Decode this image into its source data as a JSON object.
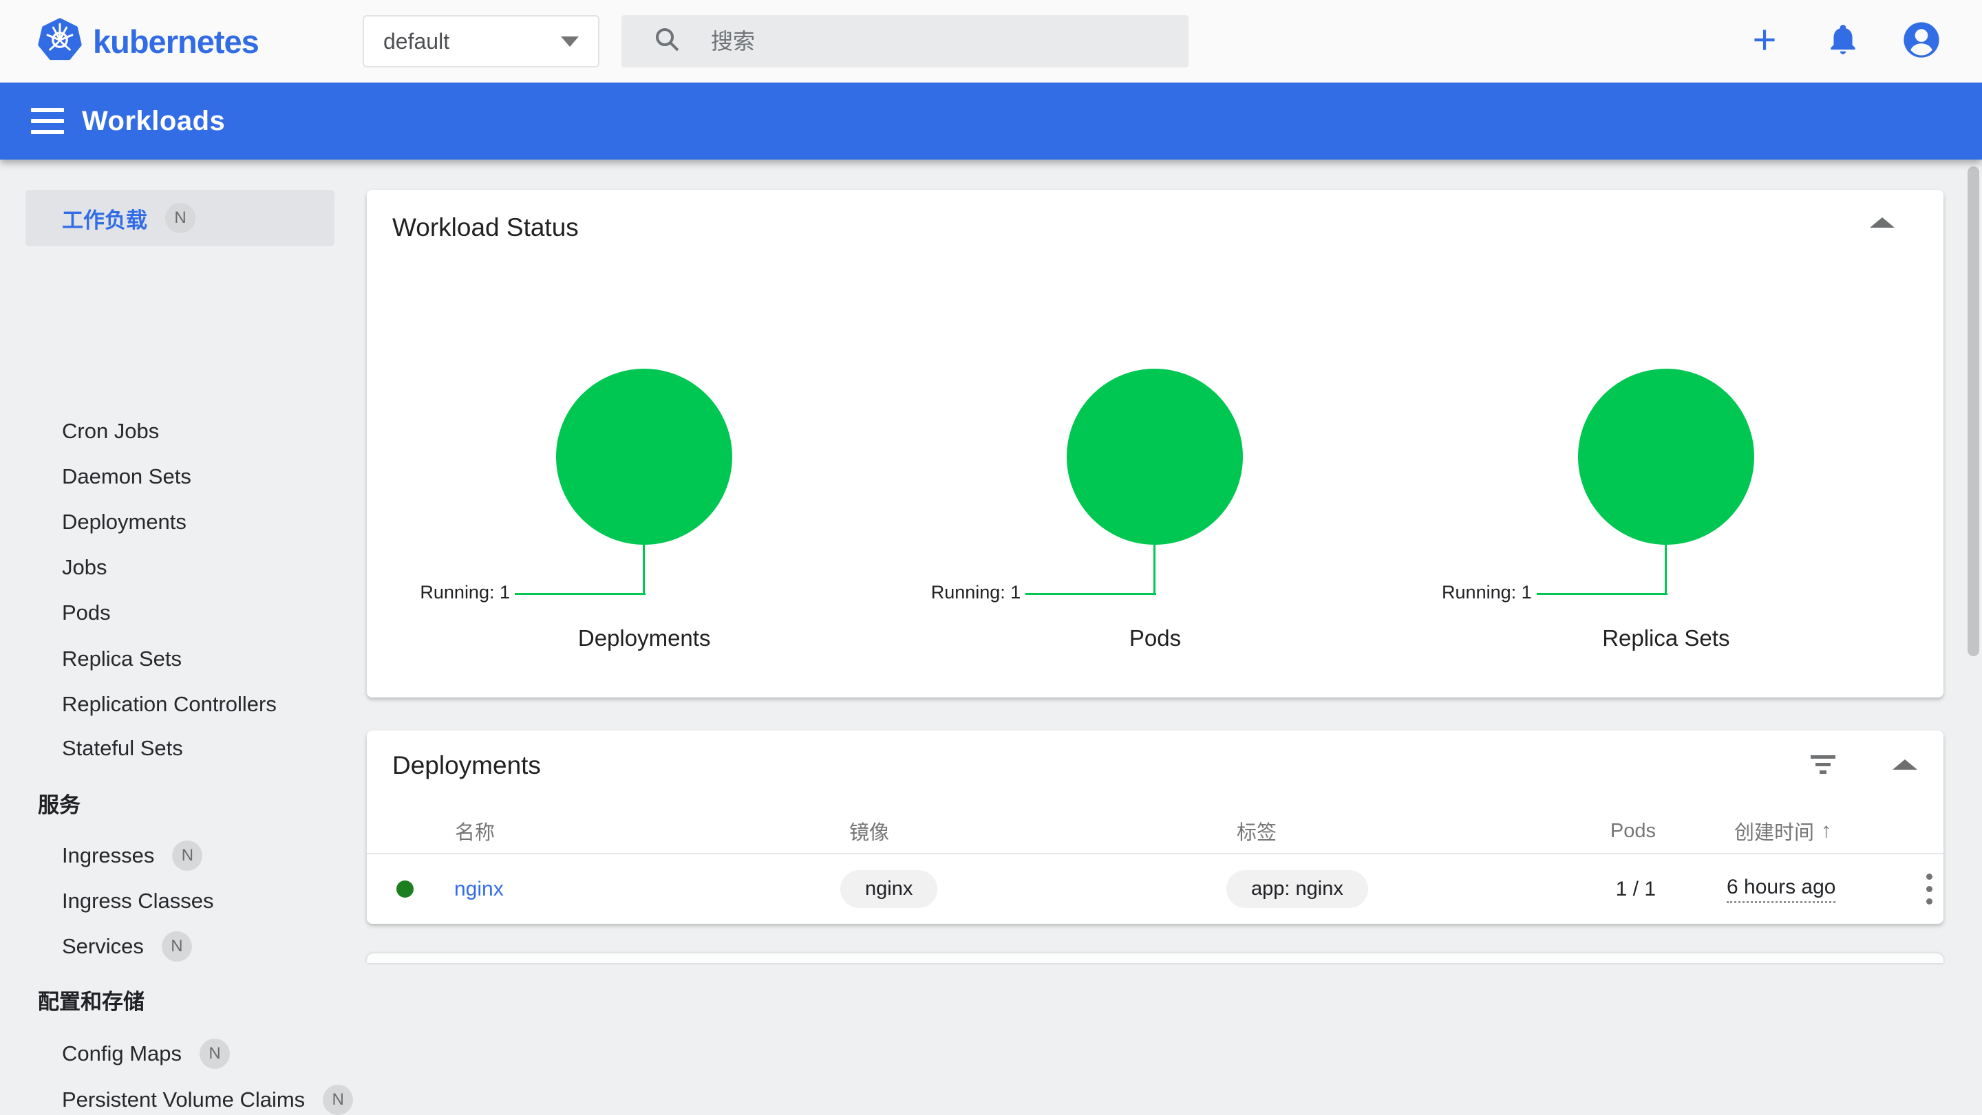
{
  "topbar": {
    "brand": "kubernetes",
    "namespace_select": {
      "value": "default"
    },
    "search": {
      "placeholder": "搜索"
    },
    "action_icons": {
      "create": "plus-icon",
      "notifications": "bell-icon",
      "profile": "user-circle-icon"
    }
  },
  "toolbar": {
    "title": "Workloads"
  },
  "sidebar": {
    "selected": {
      "label": "工作负载",
      "badge": "N"
    },
    "workload_items": [
      "Cron Jobs",
      "Daemon Sets",
      "Deployments",
      "Jobs",
      "Pods",
      "Replica Sets",
      "Replication Controllers",
      "Stateful Sets"
    ],
    "section_services": "服务",
    "services_items": [
      {
        "label": "Ingresses",
        "badge": "N"
      },
      {
        "label": "Ingress Classes",
        "badge": ""
      },
      {
        "label": "Services",
        "badge": "N"
      }
    ],
    "section_config": "配置和存储",
    "config_items": [
      {
        "label": "Config Maps",
        "badge": "N"
      },
      {
        "label": "Persistent Volume Claims",
        "badge": "N"
      }
    ]
  },
  "workload_status": {
    "title": "Workload Status",
    "charts": [
      {
        "title": "Deployments",
        "status": "Running",
        "value": 1,
        "label": "Running: 1"
      },
      {
        "title": "Pods",
        "status": "Running",
        "value": 1,
        "label": "Running: 1"
      },
      {
        "title": "Replica Sets",
        "status": "Running",
        "value": 1,
        "label": "Running: 1"
      }
    ]
  },
  "deployments_table": {
    "title": "Deployments",
    "columns": [
      "名称",
      "镜像",
      "标签",
      "Pods",
      "创建时间"
    ],
    "sort": {
      "column": "创建时间",
      "indicator": "↑"
    },
    "rows": [
      {
        "status": "Running",
        "name": "nginx",
        "image": "nginx",
        "labels": "app: nginx",
        "pods": "1 / 1",
        "created": "6 hours ago"
      }
    ]
  },
  "colors": {
    "accent_blue": "#326de6",
    "logo_blue": "#326ce5",
    "chart_green": "#00c752",
    "status_dot_green": "#1b7e1f",
    "content_bg": "#eef0f1"
  }
}
